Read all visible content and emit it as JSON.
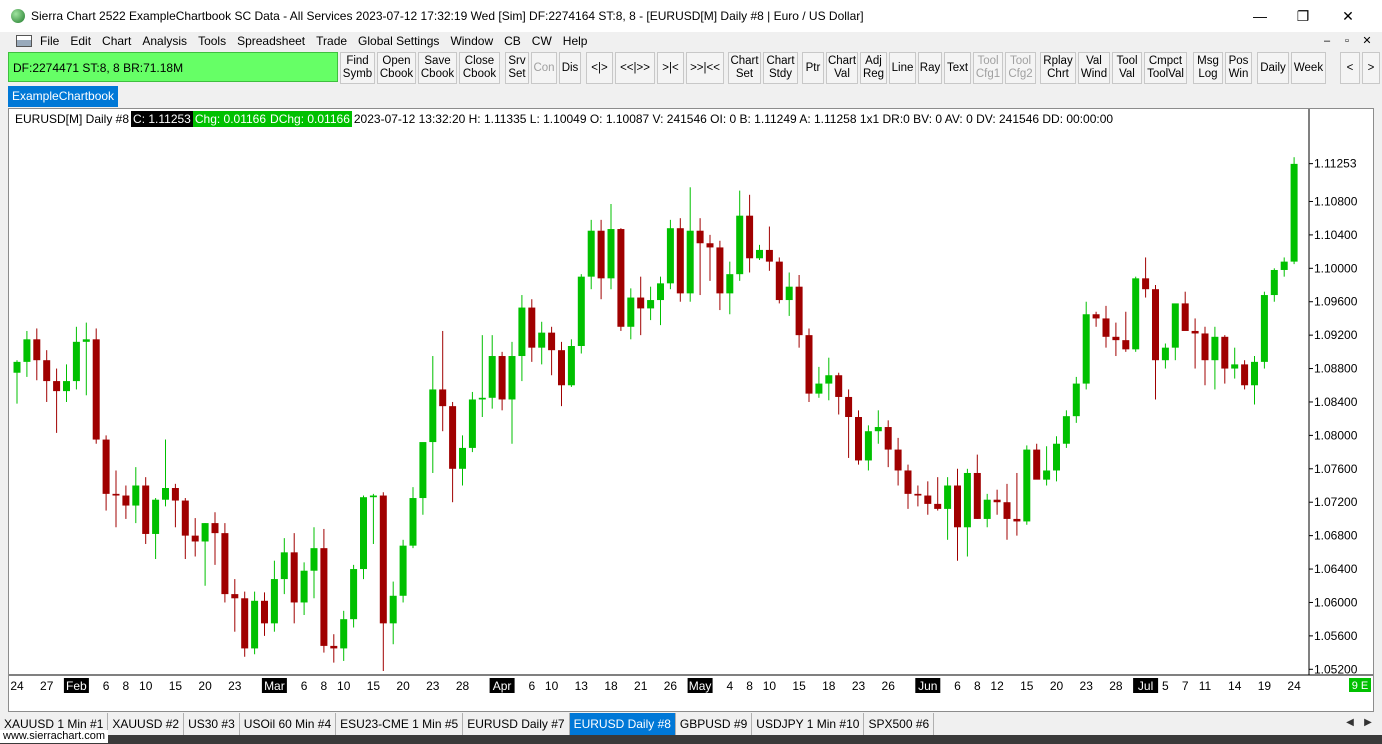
{
  "window": {
    "title": "Sierra Chart 2522 ExampleChartbook SC Data - All Services 2023-07-12  17:32:19 Wed [Sim]  DF:2274164  ST:8, 8 - [EURUSD[M]  Daily #8 | Euro / US Dollar]",
    "minimize": "—",
    "maximize": "❐",
    "close": "✕"
  },
  "menu": [
    "File",
    "Edit",
    "Chart",
    "Analysis",
    "Tools",
    "Spreadsheet",
    "Trade",
    "Global Settings",
    "Window",
    "CB",
    "CW",
    "Help"
  ],
  "status_box": "DF:2274471  ST:8, 8  BR:71.18M",
  "toolbar": [
    {
      "label": "Find\nSymb",
      "enabled": true
    },
    {
      "label": "Open\nCbook",
      "enabled": true
    },
    {
      "label": "Save\nCbook",
      "enabled": true
    },
    {
      "label": "Close\nCbook",
      "enabled": true
    },
    {
      "label": "Srv\nSet",
      "enabled": true
    },
    {
      "label": "Con",
      "enabled": false
    },
    {
      "label": "Dis",
      "enabled": true
    },
    {
      "label": "<|>",
      "enabled": true
    },
    {
      "label": "<<|>>",
      "enabled": true
    },
    {
      "label": ">|<",
      "enabled": true
    },
    {
      "label": ">>|<<",
      "enabled": true
    },
    {
      "label": "Chart\nSet",
      "enabled": true
    },
    {
      "label": "Chart\nStdy",
      "enabled": true
    },
    {
      "label": "Ptr",
      "enabled": true
    },
    {
      "label": "Chart\nVal",
      "enabled": true
    },
    {
      "label": "Adj\nReg",
      "enabled": true
    },
    {
      "label": "Line",
      "enabled": true
    },
    {
      "label": "Ray",
      "enabled": true
    },
    {
      "label": "Text",
      "enabled": true
    },
    {
      "label": "Tool\nCfg1",
      "enabled": false
    },
    {
      "label": "Tool\nCfg2",
      "enabled": false
    },
    {
      "label": "Rplay\nChrt",
      "enabled": true
    },
    {
      "label": "Val\nWind",
      "enabled": true
    },
    {
      "label": "Tool\nVal",
      "enabled": true
    },
    {
      "label": "Cmpct\nToolVal",
      "enabled": true
    },
    {
      "label": "Msg\nLog",
      "enabled": true
    },
    {
      "label": "Pos\nWin",
      "enabled": true
    },
    {
      "label": "Daily",
      "enabled": true
    },
    {
      "label": "Week",
      "enabled": true
    },
    {
      "label": "<",
      "enabled": true
    },
    {
      "label": ">",
      "enabled": true
    }
  ],
  "chartbook_tab": "ExampleChartbook",
  "info": {
    "symbol": "EURUSD[M]  Daily #8",
    "close": "C: 1.11253",
    "chg": "Chg: 0.01166",
    "dchg": "DChg: 0.01166",
    "details": "2023-07-12 13:32:20 H: 1.11335 L: 1.10049 O: 1.10087 V: 241546 OI: 0 B: 1.11249 A: 1.11258 1x1 DR:0 BV: 0 AV: 0 DV: 241546 DD: 00:00:00"
  },
  "colors": {
    "up": "#00c000",
    "down": "#a00000",
    "highlight_bg": "#000000",
    "green_bg": "#00c000",
    "accent": "#0078d7"
  },
  "chart_data": {
    "type": "candlestick",
    "instrument": "EURUSD[M] Daily #8",
    "ylim": [
      1.05,
      1.115
    ],
    "y_ticks": [
      "1.05200",
      "1.05600",
      "1.06000",
      "1.06400",
      "1.06800",
      "1.07200",
      "1.07600",
      "1.08000",
      "1.08400",
      "1.08800",
      "1.09200",
      "1.09600",
      "1.10000",
      "1.10400",
      "1.10800"
    ],
    "last_price": "1.11253",
    "x_labels": [
      {
        "i": 0,
        "t": "24",
        "hl": false
      },
      {
        "i": 3,
        "t": "27",
        "hl": false
      },
      {
        "i": 6,
        "t": "Feb",
        "hl": true
      },
      {
        "i": 9,
        "t": "6",
        "hl": false
      },
      {
        "i": 11,
        "t": "8",
        "hl": false
      },
      {
        "i": 13,
        "t": "10",
        "hl": false
      },
      {
        "i": 16,
        "t": "15",
        "hl": false
      },
      {
        "i": 19,
        "t": "20",
        "hl": false
      },
      {
        "i": 22,
        "t": "23",
        "hl": false
      },
      {
        "i": 26,
        "t": "Mar",
        "hl": true
      },
      {
        "i": 29,
        "t": "6",
        "hl": false
      },
      {
        "i": 31,
        "t": "8",
        "hl": false
      },
      {
        "i": 33,
        "t": "10",
        "hl": false
      },
      {
        "i": 36,
        "t": "15",
        "hl": false
      },
      {
        "i": 39,
        "t": "20",
        "hl": false
      },
      {
        "i": 42,
        "t": "23",
        "hl": false
      },
      {
        "i": 45,
        "t": "28",
        "hl": false
      },
      {
        "i": 49,
        "t": "Apr",
        "hl": true
      },
      {
        "i": 52,
        "t": "6",
        "hl": false
      },
      {
        "i": 54,
        "t": "10",
        "hl": false
      },
      {
        "i": 57,
        "t": "13",
        "hl": false
      },
      {
        "i": 60,
        "t": "18",
        "hl": false
      },
      {
        "i": 63,
        "t": "21",
        "hl": false
      },
      {
        "i": 66,
        "t": "26",
        "hl": false
      },
      {
        "i": 69,
        "t": "May",
        "hl": true
      },
      {
        "i": 72,
        "t": "4",
        "hl": false
      },
      {
        "i": 74,
        "t": "8",
        "hl": false
      },
      {
        "i": 76,
        "t": "10",
        "hl": false
      },
      {
        "i": 79,
        "t": "15",
        "hl": false
      },
      {
        "i": 82,
        "t": "18",
        "hl": false
      },
      {
        "i": 85,
        "t": "23",
        "hl": false
      },
      {
        "i": 88,
        "t": "26",
        "hl": false
      },
      {
        "i": 92,
        "t": "Jun",
        "hl": true
      },
      {
        "i": 95,
        "t": "6",
        "hl": false
      },
      {
        "i": 97,
        "t": "8",
        "hl": false
      },
      {
        "i": 99,
        "t": "12",
        "hl": false
      },
      {
        "i": 102,
        "t": "15",
        "hl": false
      },
      {
        "i": 105,
        "t": "20",
        "hl": false
      },
      {
        "i": 108,
        "t": "23",
        "hl": false
      },
      {
        "i": 111,
        "t": "28",
        "hl": false
      },
      {
        "i": 114,
        "t": "Jul",
        "hl": true
      },
      {
        "i": 116,
        "t": "5",
        "hl": false
      },
      {
        "i": 118,
        "t": "7",
        "hl": false
      },
      {
        "i": 120,
        "t": "11",
        "hl": false
      },
      {
        "i": 123,
        "t": "14",
        "hl": false
      },
      {
        "i": 126,
        "t": "19",
        "hl": false
      },
      {
        "i": 129,
        "t": "24",
        "hl": false
      }
    ],
    "candles": [
      [
        1.0875,
        1.089,
        1.0838,
        1.0888
      ],
      [
        1.0888,
        1.0925,
        1.087,
        1.0915
      ],
      [
        1.0915,
        1.0928,
        1.0866,
        1.089
      ],
      [
        1.089,
        1.0902,
        1.084,
        1.0865
      ],
      [
        1.0865,
        1.088,
        1.0803,
        1.0853
      ],
      [
        1.0853,
        1.0885,
        1.084,
        1.0865
      ],
      [
        1.0865,
        1.093,
        1.0855,
        1.0912
      ],
      [
        1.0912,
        1.0935,
        1.0848,
        1.0915
      ],
      [
        1.0915,
        1.0928,
        1.079,
        1.0795
      ],
      [
        1.0795,
        1.08,
        1.071,
        1.073
      ],
      [
        1.073,
        1.0758,
        1.069,
        1.0728
      ],
      [
        1.0728,
        1.074,
        1.07,
        1.0716
      ],
      [
        1.0716,
        1.0762,
        1.0695,
        1.074
      ],
      [
        1.074,
        1.075,
        1.067,
        1.0682
      ],
      [
        1.0682,
        1.0725,
        1.0652,
        1.0723
      ],
      [
        1.0723,
        1.0795,
        1.0715,
        1.0737
      ],
      [
        1.0737,
        1.0742,
        1.069,
        1.0722
      ],
      [
        1.0722,
        1.0725,
        1.0652,
        1.068
      ],
      [
        1.068,
        1.0701,
        1.0655,
        1.0673
      ],
      [
        1.0673,
        1.0695,
        1.062,
        1.0695
      ],
      [
        1.0695,
        1.0708,
        1.0645,
        1.0683
      ],
      [
        1.0683,
        1.0695,
        1.06,
        1.061
      ],
      [
        1.061,
        1.0628,
        1.0565,
        1.0605
      ],
      [
        1.0605,
        1.0613,
        1.0535,
        1.0545
      ],
      [
        1.0545,
        1.0613,
        1.0538,
        1.0602
      ],
      [
        1.0602,
        1.0612,
        1.056,
        1.0575
      ],
      [
        1.0575,
        1.065,
        1.0565,
        1.0628
      ],
      [
        1.0628,
        1.0677,
        1.061,
        1.066
      ],
      [
        1.066,
        1.0683,
        1.0575,
        1.06
      ],
      [
        1.06,
        1.0648,
        1.0585,
        1.0638
      ],
      [
        1.0638,
        1.069,
        1.0605,
        1.0665
      ],
      [
        1.0665,
        1.0688,
        1.054,
        1.0548
      ],
      [
        1.0548,
        1.0562,
        1.0528,
        1.0545
      ],
      [
        1.0545,
        1.059,
        1.053,
        1.058
      ],
      [
        1.058,
        1.0645,
        1.057,
        1.064
      ],
      [
        1.064,
        1.0728,
        1.0628,
        1.0726
      ],
      [
        1.0726,
        1.073,
        1.067,
        1.0728
      ],
      [
        1.0728,
        1.0732,
        1.0518,
        1.0575
      ],
      [
        1.0575,
        1.0625,
        1.055,
        1.0608
      ],
      [
        1.0608,
        1.0675,
        1.06,
        1.0668
      ],
      [
        1.0668,
        1.0738,
        1.0665,
        1.0725
      ],
      [
        1.0725,
        1.0782,
        1.0705,
        1.0792
      ],
      [
        1.0792,
        1.0895,
        1.0755,
        1.0855
      ],
      [
        1.0855,
        1.0925,
        1.0805,
        1.0835
      ],
      [
        1.0835,
        1.084,
        1.072,
        1.076
      ],
      [
        1.076,
        1.08,
        1.074,
        1.0785
      ],
      [
        1.0785,
        1.0852,
        1.078,
        1.0843
      ],
      [
        1.0843,
        1.092,
        1.0822,
        1.0845
      ],
      [
        1.0845,
        1.092,
        1.0832,
        1.0895
      ],
      [
        1.0895,
        1.09,
        1.083,
        1.0843
      ],
      [
        1.0843,
        1.0912,
        1.079,
        1.0895
      ],
      [
        1.0895,
        1.0968,
        1.0865,
        1.0953
      ],
      [
        1.0953,
        1.0963,
        1.0888,
        1.0905
      ],
      [
        1.0905,
        1.0936,
        1.0885,
        1.0923
      ],
      [
        1.0923,
        1.093,
        1.0872,
        1.0902
      ],
      [
        1.0902,
        1.0912,
        1.0835,
        1.086
      ],
      [
        1.086,
        1.0915,
        1.0858,
        1.0907
      ],
      [
        1.0907,
        1.0993,
        1.0898,
        1.099
      ],
      [
        1.099,
        1.1058,
        1.0975,
        1.1045
      ],
      [
        1.1045,
        1.1058,
        1.0963,
        1.0988
      ],
      [
        1.0988,
        1.1077,
        1.0975,
        1.1047
      ],
      [
        1.1047,
        1.1048,
        1.0925,
        1.093
      ],
      [
        1.093,
        1.0976,
        1.0915,
        1.0965
      ],
      [
        1.0965,
        1.099,
        1.092,
        1.0952
      ],
      [
        1.0952,
        1.0978,
        1.0938,
        1.0962
      ],
      [
        1.0962,
        1.099,
        1.0932,
        1.0982
      ],
      [
        1.0982,
        1.1058,
        1.0975,
        1.1048
      ],
      [
        1.1048,
        1.106,
        1.096,
        1.097
      ],
      [
        1.097,
        1.1097,
        1.096,
        1.1045
      ],
      [
        1.1045,
        1.106,
        1.0968,
        1.103
      ],
      [
        1.103,
        1.104,
        1.0985,
        1.1025
      ],
      [
        1.1025,
        1.1033,
        1.095,
        1.097
      ],
      [
        1.097,
        1.1008,
        1.0945,
        1.0993
      ],
      [
        1.0993,
        1.1093,
        1.0985,
        1.1063
      ],
      [
        1.1063,
        1.1088,
        1.0995,
        1.1012
      ],
      [
        1.1012,
        1.1028,
        1.101,
        1.1022
      ],
      [
        1.1022,
        1.105,
        1.0997,
        1.1008
      ],
      [
        1.1008,
        1.1013,
        1.0958,
        1.0962
      ],
      [
        1.0962,
        1.0995,
        1.0943,
        1.0978
      ],
      [
        1.0978,
        1.0992,
        1.0905,
        1.092
      ],
      [
        1.092,
        1.0928,
        1.084,
        1.085
      ],
      [
        1.085,
        1.0882,
        1.0845,
        1.0862
      ],
      [
        1.0862,
        1.0893,
        1.0842,
        1.0872
      ],
      [
        1.0872,
        1.0875,
        1.0825,
        1.0846
      ],
      [
        1.0846,
        1.0855,
        1.0773,
        1.0822
      ],
      [
        1.0822,
        1.083,
        1.0765,
        1.077
      ],
      [
        1.077,
        1.0812,
        1.0758,
        1.0805
      ],
      [
        1.0805,
        1.083,
        1.079,
        1.081
      ],
      [
        1.081,
        1.0818,
        1.0762,
        1.0783
      ],
      [
        1.0783,
        1.0797,
        1.074,
        1.0758
      ],
      [
        1.0758,
        1.0765,
        1.0712,
        1.073
      ],
      [
        1.073,
        1.074,
        1.0715,
        1.0728
      ],
      [
        1.0728,
        1.0745,
        1.0705,
        1.0718
      ],
      [
        1.0718,
        1.075,
        1.071,
        1.0712
      ],
      [
        1.0712,
        1.075,
        1.0675,
        1.074
      ],
      [
        1.074,
        1.076,
        1.065,
        1.069
      ],
      [
        1.069,
        1.076,
        1.0655,
        1.0755
      ],
      [
        1.0755,
        1.0777,
        1.07,
        1.07
      ],
      [
        1.07,
        1.073,
        1.069,
        1.0723
      ],
      [
        1.0723,
        1.0735,
        1.0705,
        1.072
      ],
      [
        1.072,
        1.0742,
        1.0675,
        1.07
      ],
      [
        1.07,
        1.0755,
        1.068,
        1.0697
      ],
      [
        1.0697,
        1.0788,
        1.0693,
        1.0783
      ],
      [
        1.0783,
        1.079,
        1.0755,
        1.0747
      ],
      [
        1.0747,
        1.0787,
        1.074,
        1.0758
      ],
      [
        1.0758,
        1.0799,
        1.0745,
        1.079
      ],
      [
        1.079,
        1.083,
        1.0785,
        1.0823
      ],
      [
        1.0823,
        1.087,
        1.0815,
        1.0862
      ],
      [
        1.0862,
        1.096,
        1.0855,
        1.0945
      ],
      [
        1.0945,
        1.0948,
        1.093,
        1.094
      ],
      [
        1.094,
        1.0955,
        1.0905,
        1.0918
      ],
      [
        1.0918,
        1.0935,
        1.0895,
        1.0914
      ],
      [
        1.0914,
        1.0948,
        1.09,
        1.0903
      ],
      [
        1.0903,
        1.099,
        1.09,
        1.0988
      ],
      [
        1.0988,
        1.1013,
        1.0965,
        1.0975
      ],
      [
        1.0975,
        1.098,
        1.0843,
        1.089
      ],
      [
        1.089,
        1.091,
        1.088,
        1.0905
      ],
      [
        1.0905,
        1.0945,
        1.089,
        1.0958
      ],
      [
        1.0958,
        1.0972,
        1.093,
        1.0925
      ],
      [
        1.0925,
        1.094,
        1.088,
        1.0922
      ],
      [
        1.0922,
        1.093,
        1.086,
        1.089
      ],
      [
        1.089,
        1.093,
        1.0855,
        1.0918
      ],
      [
        1.0918,
        1.092,
        1.0862,
        1.088
      ],
      [
        1.088,
        1.0905,
        1.0868,
        1.0885
      ],
      [
        1.0885,
        1.089,
        1.0855,
        1.086
      ],
      [
        1.086,
        1.0895,
        1.0837,
        1.0888
      ],
      [
        1.0888,
        1.0972,
        1.088,
        1.0968
      ],
      [
        1.0968,
        1.1,
        1.096,
        1.0998
      ],
      [
        1.0998,
        1.1013,
        1.099,
        1.1008
      ],
      [
        1.1008,
        1.1133,
        1.1005,
        1.1125
      ]
    ]
  },
  "bottom_tabs": [
    {
      "label": "XAUUSD  1 Min  #1",
      "active": false
    },
    {
      "label": "XAUUSD #2",
      "active": false
    },
    {
      "label": "US30 #3",
      "active": false
    },
    {
      "label": "USOil  60 Min  #4",
      "active": false
    },
    {
      "label": "ESU23-CME  1 Min  #5",
      "active": false
    },
    {
      "label": "EURUSD  Daily #7",
      "active": false
    },
    {
      "label": "EURUSD  Daily #8",
      "active": true
    },
    {
      "label": "GBPUSD #9",
      "active": false
    },
    {
      "label": "USDJPY  1 Min  #10",
      "active": false
    },
    {
      "label": "SPX500 #6",
      "active": false
    }
  ],
  "footer_link": "www.sierrachart.com",
  "corner_badge": "9 E",
  "scroll_left": "◀",
  "scroll_right": "▶"
}
